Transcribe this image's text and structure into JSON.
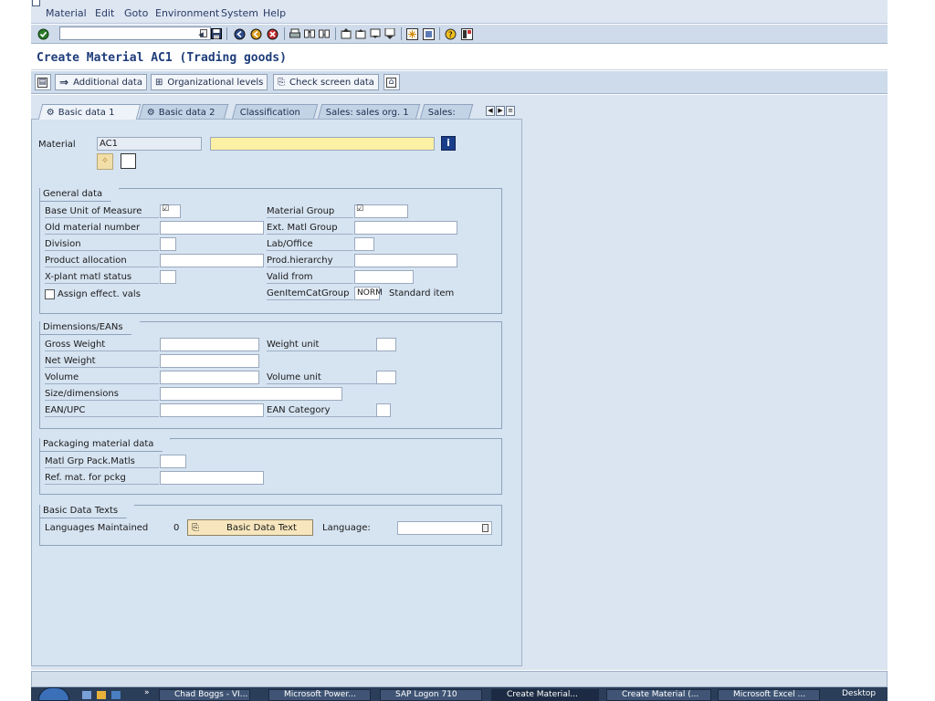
{
  "menubar": {
    "items": [
      {
        "label": "Material",
        "key": "M"
      },
      {
        "label": "Edit",
        "key": "E"
      },
      {
        "label": "Goto",
        "key": "G"
      },
      {
        "label": "Environment",
        "key": "n"
      },
      {
        "label": "System",
        "key": "S"
      },
      {
        "label": "Help",
        "key": "H"
      }
    ]
  },
  "toolbar": {
    "command_field_value": ""
  },
  "title": "Create Material AC1 (Trading goods)",
  "app_toolbar": {
    "additional_data": "Additional data",
    "org_levels": "Organizational levels",
    "check_screen": "Check screen data"
  },
  "tabs": [
    {
      "label": "Basic data 1",
      "active": true
    },
    {
      "label": "Basic data 2",
      "active": false
    },
    {
      "label": "Classification",
      "active": false
    },
    {
      "label": "Sales: sales org. 1",
      "active": false
    },
    {
      "label": "Sales:",
      "active": false
    }
  ],
  "header": {
    "material_label": "Material",
    "material_value": "AC1",
    "description_value": ""
  },
  "general": {
    "title": "General data",
    "base_uom": "Base Unit of Measure",
    "old_matnr": "Old material number",
    "division": "Division",
    "prod_alloc": "Product allocation",
    "xplant_status": "X-plant matl status",
    "assign_eff": "Assign effect. vals",
    "matl_group": "Material Group",
    "ext_matl_group": "Ext. Matl Group",
    "lab_office": "Lab/Office",
    "prod_hier": "Prod.hierarchy",
    "valid_from": "Valid from",
    "gen_item_cat": "GenItemCatGroup",
    "gen_item_cat_value": "NORM",
    "gen_item_cat_text": "Standard item"
  },
  "dimensions": {
    "title": "Dimensions/EANs",
    "gross_weight": "Gross Weight",
    "net_weight": "Net Weight",
    "volume": "Volume",
    "size_dim": "Size/dimensions",
    "ean_upc": "EAN/UPC",
    "weight_unit": "Weight unit",
    "volume_unit": "Volume unit",
    "ean_category": "EAN Category"
  },
  "packaging": {
    "title": "Packaging material data",
    "matl_grp_pack": "Matl Grp Pack.Matls",
    "ref_mat": "Ref. mat. for pckg"
  },
  "texts": {
    "title": "Basic Data Texts",
    "languages": "Languages Maintained",
    "lang_count": "0",
    "btn": "Basic Data Text",
    "language_label": "Language:"
  },
  "taskbar": {
    "items": [
      {
        "label": "Chad Boggs - VI...",
        "active": false
      },
      {
        "label": "Microsoft Power...",
        "active": false
      },
      {
        "label": "SAP Logon 710",
        "active": false
      },
      {
        "label": "Create Material...",
        "active": true
      },
      {
        "label": "Create Material (...",
        "active": false
      },
      {
        "label": "Microsoft Excel ...",
        "active": false
      },
      {
        "label": "Desktop",
        "active": false
      }
    ]
  }
}
